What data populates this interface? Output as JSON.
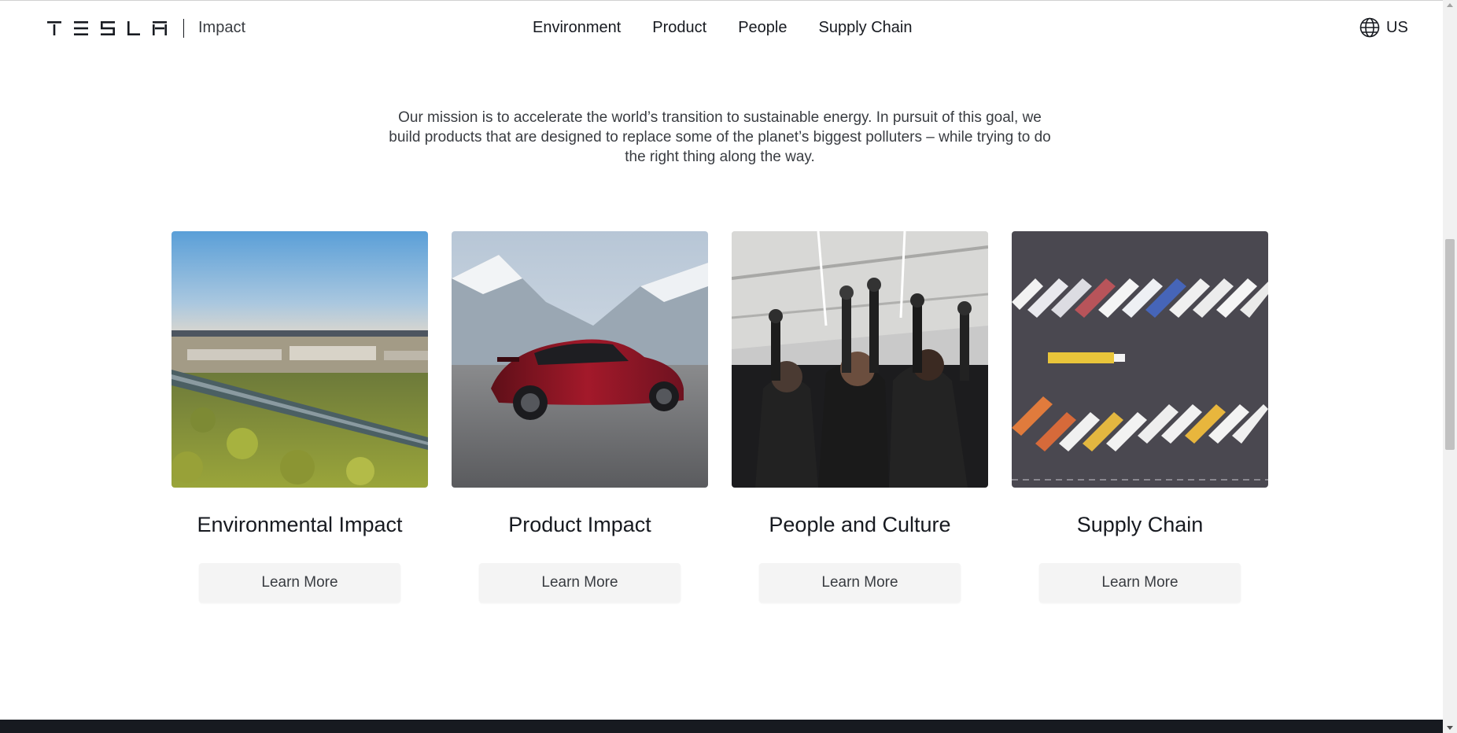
{
  "header": {
    "logo_alt": "TESLA",
    "section": "Impact",
    "nav": [
      "Environment",
      "Product",
      "People",
      "Supply Chain"
    ],
    "locale": "US"
  },
  "mission": "Our mission is to accelerate the world’s transition to sustainable energy. In pursuit of this goal, we build products that are designed to replace some of the planet’s biggest polluters – while trying to do the right thing along the way.",
  "cards": [
    {
      "title": "Environmental Impact",
      "button": "Learn More",
      "image": "aerial-gigafactory-forest"
    },
    {
      "title": "Product Impact",
      "button": "Learn More",
      "image": "red-model-y-mountains"
    },
    {
      "title": "People and Culture",
      "button": "Learn More",
      "image": "team-raised-fists"
    },
    {
      "title": "Supply Chain",
      "button": "Learn More",
      "image": "aerial-truck-trailers"
    }
  ],
  "colors": {
    "text": "#171a20",
    "muted": "#393c41",
    "button_bg": "#f4f4f4",
    "footer": "#171a20"
  }
}
